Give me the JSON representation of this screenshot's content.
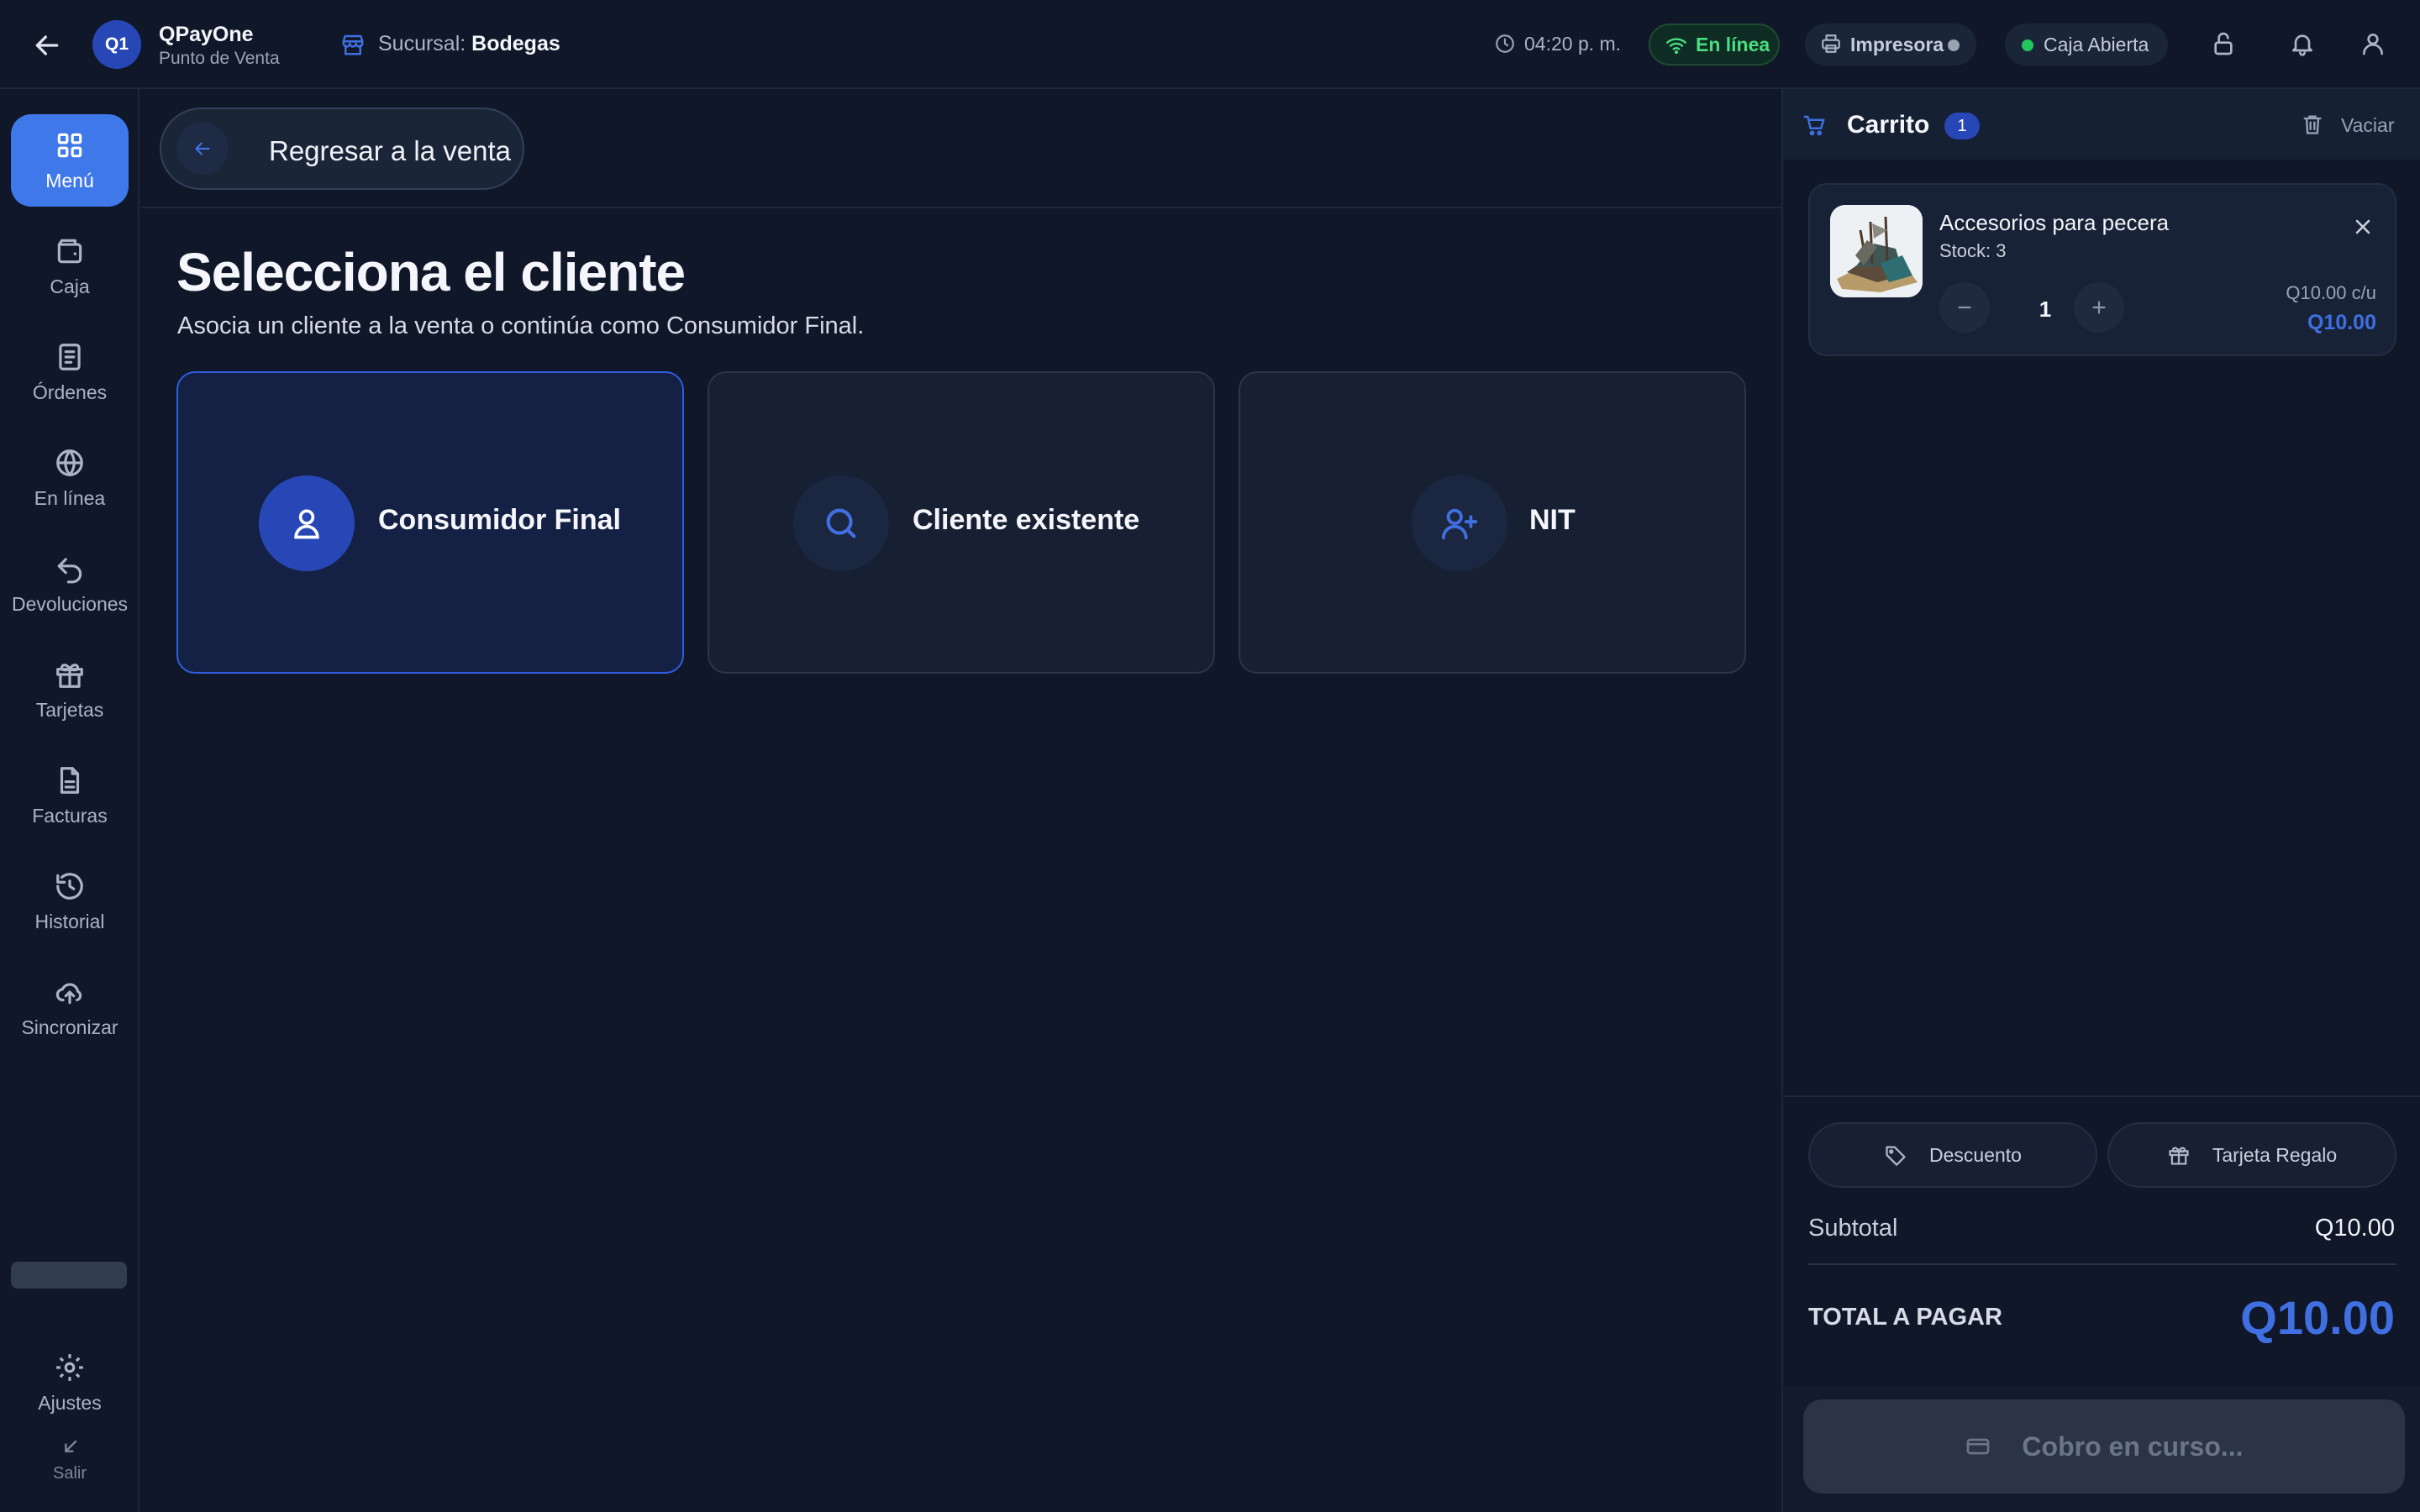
{
  "topbar": {
    "logo": "Q1",
    "app_name": "QPayOne",
    "app_subtitle": "Punto de Venta",
    "branch_label": "Sucursal:",
    "branch_name": "Bodegas",
    "time": "04:20 p. m.",
    "online_status": "En línea",
    "printer_label": "Impresora",
    "cash_status": "Caja Abierta"
  },
  "sidebar": {
    "items": [
      {
        "label": "Menú",
        "icon": "grid-icon"
      },
      {
        "label": "Caja",
        "icon": "wallet-icon"
      },
      {
        "label": "Órdenes",
        "icon": "orders-icon"
      },
      {
        "label": "En línea",
        "icon": "globe-icon"
      },
      {
        "label": "Devoluciones",
        "icon": "undo-icon"
      },
      {
        "label": "Tarjetas",
        "icon": "gift-icon"
      },
      {
        "label": "Facturas",
        "icon": "invoice-icon"
      },
      {
        "label": "Historial",
        "icon": "history-icon"
      },
      {
        "label": "Sincronizar",
        "icon": "cloud-upload-icon"
      }
    ],
    "settings_label": "Ajustes",
    "exit_label": "Salir"
  },
  "main": {
    "return_button": "Regresar a la venta",
    "title": "Selecciona el cliente",
    "subtitle": "Asocia un cliente a la venta o continúa como Consumidor Final.",
    "options": [
      {
        "label": "Consumidor Final",
        "icon": "user-icon",
        "selected": true
      },
      {
        "label": "Cliente existente",
        "icon": "search-icon",
        "selected": false
      },
      {
        "label": "NIT",
        "icon": "user-plus-icon",
        "selected": false
      }
    ]
  },
  "cart": {
    "title": "Carrito",
    "count": "1",
    "clear_label": "Vaciar",
    "items": [
      {
        "name": "Accesorios para pecera",
        "stock": "Stock: 3",
        "quantity": "1",
        "unit_price": "Q10.00 c/u",
        "line_total": "Q10.00"
      }
    ],
    "discount_label": "Descuento",
    "gift_card_label": "Tarjeta Regalo",
    "subtotal_label": "Subtotal",
    "subtotal_value": "Q10.00",
    "total_label": "TOTAL A PAGAR",
    "total_value": "Q10.00",
    "pay_button": "Cobro en curso..."
  },
  "colors": {
    "background": "#0f1729",
    "accent": "#3f6fe0",
    "active_nav": "#3f78e8",
    "online_green": "#4ade80"
  }
}
